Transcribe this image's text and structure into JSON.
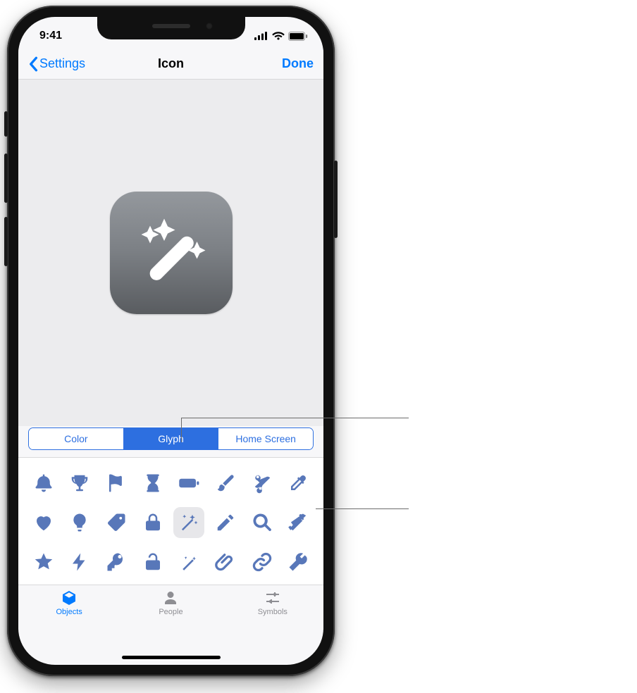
{
  "status": {
    "time": "9:41"
  },
  "nav": {
    "back": "Settings",
    "title": "Icon",
    "done": "Done"
  },
  "segments": {
    "items": [
      {
        "label": "Color",
        "selected": false
      },
      {
        "label": "Glyph",
        "selected": true
      },
      {
        "label": "Home Screen",
        "selected": false
      }
    ]
  },
  "preview": {
    "glyph": "magic-wand"
  },
  "glyph_grid": {
    "rows": [
      [
        "bell",
        "trophy",
        "flag",
        "hourglass",
        "battery",
        "brush",
        "scissors",
        "eyedropper"
      ],
      [
        "heart",
        "lightbulb",
        "tag",
        "lock",
        "magic-wand",
        "pencil",
        "magnifier",
        "hammer"
      ],
      [
        "star",
        "bolt",
        "key",
        "unlock",
        "wand",
        "paperclip",
        "link",
        "wrench"
      ]
    ],
    "selected": "magic-wand"
  },
  "tabs": {
    "items": [
      {
        "label": "Objects",
        "icon": "cube",
        "selected": true
      },
      {
        "label": "People",
        "icon": "person",
        "selected": false
      },
      {
        "label": "Symbols",
        "icon": "sliders",
        "selected": false
      }
    ]
  }
}
